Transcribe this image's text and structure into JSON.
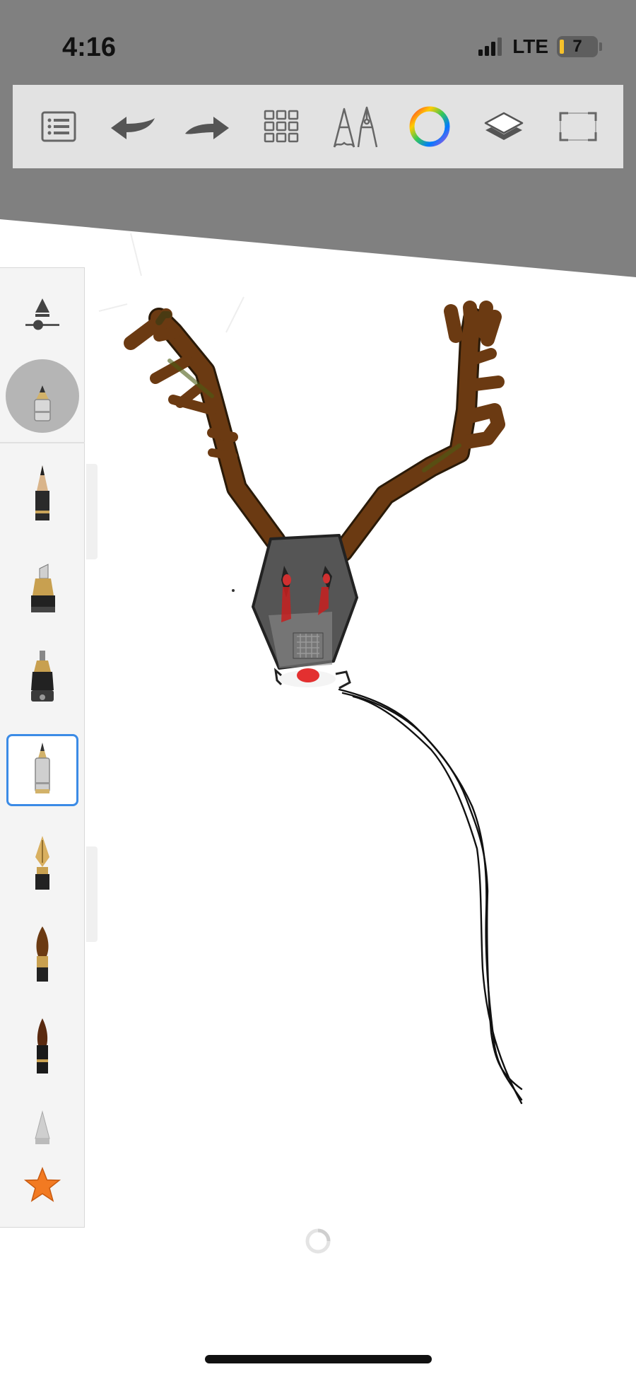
{
  "status_bar": {
    "time": "4:16",
    "network": "LTE",
    "battery_level": "7",
    "signal_bars": 3
  },
  "toolbar": {
    "items": [
      {
        "icon": "list-icon",
        "label": ""
      },
      {
        "icon": "undo-icon",
        "label": ""
      },
      {
        "icon": "redo-icon",
        "label": ""
      },
      {
        "icon": "grid-icon",
        "label": ""
      },
      {
        "icon": "brushes-icon",
        "label": ""
      },
      {
        "icon": "color-wheel-icon",
        "label": ""
      },
      {
        "icon": "layers-icon",
        "label": ""
      },
      {
        "icon": "fullscreen-icon",
        "label": ""
      }
    ]
  },
  "brush_panel": {
    "selected_brush": "technical-pen",
    "brushes": [
      "pencil",
      "marker",
      "felt-pen",
      "technical-pen",
      "fountain-pen",
      "paintbrush",
      "watercolor-brush",
      "airbrush",
      "favorites-star"
    ]
  },
  "colors": {
    "accent": "#3b8be6",
    "toolbar_bg": "#e2e2e2",
    "backdrop": "#808080",
    "antler": "#6b3a12",
    "star": "#f27a22"
  }
}
